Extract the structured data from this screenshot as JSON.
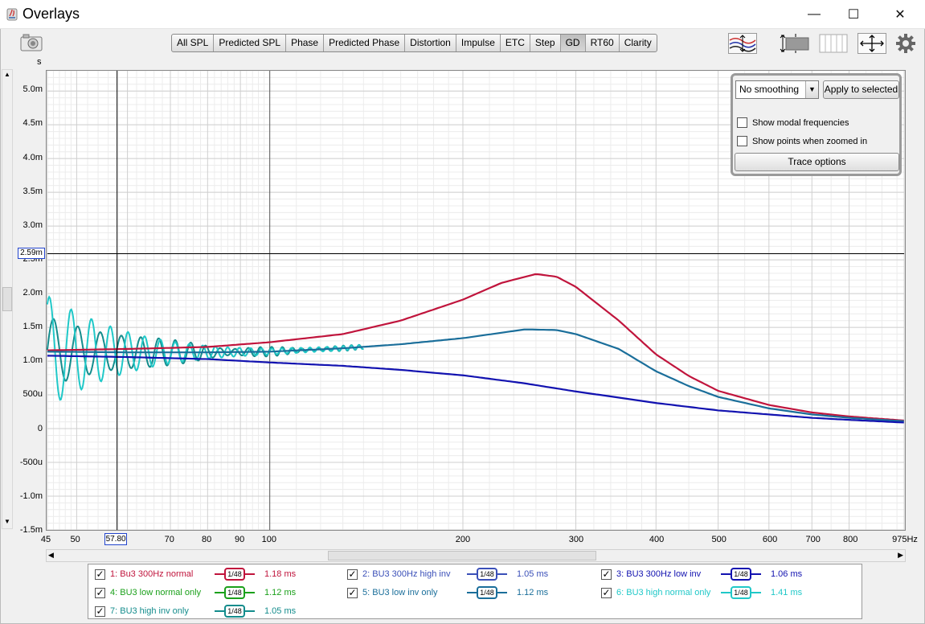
{
  "window": {
    "title": "Overlays",
    "minimize": "—",
    "maximize": "☐",
    "close": "✕"
  },
  "tabs": [
    "All SPL",
    "Predicted SPL",
    "Phase",
    "Predicted Phase",
    "Distortion",
    "Impulse",
    "ETC",
    "Step",
    "GD",
    "RT60",
    "Clarity"
  ],
  "active_tab": "GD",
  "panel": {
    "smoothing": "No  smoothing",
    "apply_label": "Apply to selected",
    "modal_label": "Show modal frequencies",
    "points_label": "Show points when zoomed in",
    "trace_label": "Trace options"
  },
  "cursor": {
    "y_readout": "2.59m",
    "x_readout": "57.80"
  },
  "chart_data": {
    "type": "line",
    "ylabel": "s",
    "xlabel": "Hz",
    "x_scale": "log",
    "xlim": [
      45,
      975
    ],
    "ylim": [
      -0.0015,
      0.0053
    ],
    "x_ticks": [
      {
        "v": 45,
        "t": "45"
      },
      {
        "v": 50,
        "t": "50"
      },
      {
        "v": 60,
        "t": ""
      },
      {
        "v": 70,
        "t": "70"
      },
      {
        "v": 80,
        "t": "80"
      },
      {
        "v": 90,
        "t": "90"
      },
      {
        "v": 100,
        "t": "100"
      },
      {
        "v": 200,
        "t": "200"
      },
      {
        "v": 300,
        "t": "300"
      },
      {
        "v": 400,
        "t": "400"
      },
      {
        "v": 500,
        "t": "500"
      },
      {
        "v": 600,
        "t": "600"
      },
      {
        "v": 700,
        "t": "700"
      },
      {
        "v": 800,
        "t": "800"
      },
      {
        "v": 975,
        "t": "975Hz"
      }
    ],
    "y_ticks": [
      {
        "v": 0.005,
        "t": "5.0m"
      },
      {
        "v": 0.0045,
        "t": "4.5m"
      },
      {
        "v": 0.004,
        "t": "4.0m"
      },
      {
        "v": 0.0035,
        "t": "3.5m"
      },
      {
        "v": 0.003,
        "t": "3.0m"
      },
      {
        "v": 0.0025,
        "t": "2.5m"
      },
      {
        "v": 0.002,
        "t": "2.0m"
      },
      {
        "v": 0.0015,
        "t": "1.5m"
      },
      {
        "v": 0.001,
        "t": "1.0m"
      },
      {
        "v": 0.0005,
        "t": "500u"
      },
      {
        "v": 0,
        "t": "0"
      },
      {
        "v": -0.0005,
        "t": "-500u"
      },
      {
        "v": -0.001,
        "t": "-1.0m"
      },
      {
        "v": -0.0015,
        "t": "-1.5m"
      }
    ],
    "cursor": {
      "x": 57.8,
      "y": 0.00259
    },
    "series": [
      {
        "name": "1: Bu3 300Hz normal",
        "color": "#c0143c",
        "points": [
          [
            45,
            0.00116
          ],
          [
            60,
            0.00118
          ],
          [
            80,
            0.00121
          ],
          [
            100,
            0.00128
          ],
          [
            130,
            0.0014
          ],
          [
            160,
            0.0016
          ],
          [
            200,
            0.00191
          ],
          [
            230,
            0.00216
          ],
          [
            260,
            0.00229
          ],
          [
            280,
            0.00225
          ],
          [
            300,
            0.0021
          ],
          [
            350,
            0.0016
          ],
          [
            400,
            0.0011
          ],
          [
            450,
            0.00078
          ],
          [
            500,
            0.00056
          ],
          [
            600,
            0.00035
          ],
          [
            700,
            0.00024
          ],
          [
            800,
            0.00018
          ],
          [
            975,
            0.00012
          ]
        ]
      },
      {
        "name": "5: BU3  low inv only",
        "color": "#1a6e9a",
        "points": [
          [
            45,
            0.00114
          ],
          [
            60,
            0.00113
          ],
          [
            80,
            0.00113
          ],
          [
            100,
            0.00114
          ],
          [
            130,
            0.00119
          ],
          [
            160,
            0.00125
          ],
          [
            200,
            0.00134
          ],
          [
            250,
            0.00147
          ],
          [
            280,
            0.00146
          ],
          [
            300,
            0.0014
          ],
          [
            350,
            0.00118
          ],
          [
            400,
            0.00085
          ],
          [
            450,
            0.00063
          ],
          [
            500,
            0.00047
          ],
          [
            600,
            0.0003
          ],
          [
            700,
            0.00021
          ],
          [
            800,
            0.00016
          ],
          [
            975,
            0.00011
          ]
        ]
      },
      {
        "name": "3: BU3 300Hz low inv",
        "color": "#1212b0",
        "points": [
          [
            45,
            0.00108
          ],
          [
            60,
            0.00106
          ],
          [
            80,
            0.00103
          ],
          [
            100,
            0.00098
          ],
          [
            130,
            0.00093
          ],
          [
            160,
            0.00087
          ],
          [
            200,
            0.00079
          ],
          [
            250,
            0.00067
          ],
          [
            300,
            0.00055
          ],
          [
            350,
            0.00046
          ],
          [
            400,
            0.00038
          ],
          [
            500,
            0.00027
          ],
          [
            600,
            0.00021
          ],
          [
            700,
            0.00016
          ],
          [
            800,
            0.00013
          ],
          [
            975,
            9e-05
          ]
        ]
      }
    ],
    "oscillating_series": [
      {
        "name": "7: BU3  high inv only",
        "color": "#138c8c",
        "amp": 0.0005,
        "period_hz": 4.2
      },
      {
        "name": "6: BU3  high normal only",
        "color": "#20c8c8",
        "amp": 0.0008,
        "period_hz": 3.7
      }
    ]
  },
  "legend": [
    {
      "name": "1: Bu3 300Hz normal",
      "value": "1.18 ms",
      "color": "#c0143c",
      "smooth": "1/48"
    },
    {
      "name": "2: BU3 300Hz high inv",
      "value": "1.05 ms",
      "color": "#3a4fb8",
      "smooth": "1/48"
    },
    {
      "name": "3: BU3 300Hz low inv",
      "value": "1.06 ms",
      "color": "#1212b0",
      "smooth": "1/48"
    },
    {
      "name": "4: BU3  low normal only",
      "value": "1.12 ms",
      "color": "#1aa01a",
      "smooth": "1/48"
    },
    {
      "name": "5: BU3  low inv only",
      "value": "1.12 ms",
      "color": "#1a6e9a",
      "smooth": "1/48"
    },
    {
      "name": "6: BU3  high normal only",
      "value": "1.41 ms",
      "color": "#20c8c8",
      "smooth": "1/48"
    },
    {
      "name": "7: BU3  high inv only",
      "value": "1.05 ms",
      "color": "#138c8c",
      "smooth": "1/48"
    }
  ]
}
